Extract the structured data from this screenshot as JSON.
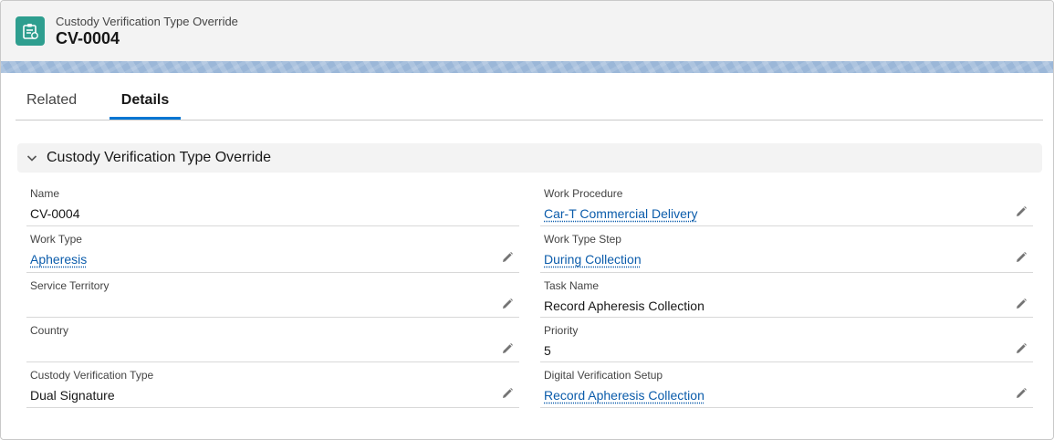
{
  "header": {
    "object_label": "Custody Verification Type Override",
    "record_name": "CV-0004",
    "icon": "record-icon"
  },
  "tabs": [
    {
      "label": "Related",
      "active": false
    },
    {
      "label": "Details",
      "active": true
    }
  ],
  "section": {
    "title": "Custody Verification Type Override",
    "expanded": true
  },
  "fields": {
    "name": {
      "label": "Name",
      "value": "CV-0004",
      "editable": false
    },
    "work_procedure": {
      "label": "Work Procedure",
      "value": "Car-T Commercial Delivery",
      "link": true,
      "editable": true
    },
    "work_type": {
      "label": "Work Type",
      "value": "Apheresis",
      "link": true,
      "editable": true
    },
    "work_type_step": {
      "label": "Work Type Step",
      "value": "During Collection",
      "link": true,
      "editable": true
    },
    "service_territory": {
      "label": "Service Territory",
      "value": "",
      "editable": true
    },
    "task_name": {
      "label": "Task Name",
      "value": "Record Apheresis Collection",
      "editable": true
    },
    "country": {
      "label": "Country",
      "value": "",
      "editable": true
    },
    "priority": {
      "label": "Priority",
      "value": "5",
      "editable": true
    },
    "custody_verification_type": {
      "label": "Custody Verification Type",
      "value": "Dual Signature",
      "editable": true
    },
    "digital_verification_setup": {
      "label": "Digital Verification Setup",
      "value": "Record Apheresis Collection",
      "link": true,
      "editable": true
    }
  },
  "colors": {
    "icon_bg": "#2e9e8f",
    "tab_active": "#0176d3",
    "link": "#0b5cab",
    "band": "#9bb7d8"
  }
}
